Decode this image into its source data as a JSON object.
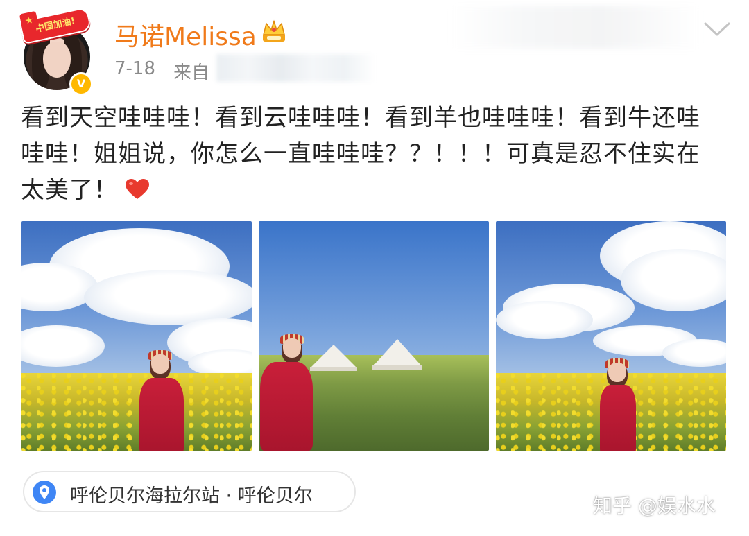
{
  "header": {
    "badge_text": "中国加油!",
    "username": "马诺Melissa",
    "date": "7-18",
    "source_label": "来自",
    "verified_icon": "verified-v-icon",
    "vip_icon": "crown-icon",
    "menu_icon": "chevron-down-icon",
    "colors": {
      "username": "#f07a1a",
      "meta": "#8a8a8a",
      "verified": "#ffb800",
      "badge": "#e8272c"
    }
  },
  "post": {
    "text": "看到天空哇哇哇！看到云哇哇哇！看到羊也哇哇哇！看到牛还哇哇哇！姐姐说，你怎么一直哇哇哇？？！！！可真是忍不住实在太美了！",
    "emoji": "heart-icon"
  },
  "photos": [
    {
      "name": "photo-rapeseed-field-1"
    },
    {
      "name": "photo-grassland-tents"
    },
    {
      "name": "photo-rapeseed-field-2"
    }
  ],
  "location": {
    "icon": "location-pin-icon",
    "place": "呼伦贝尔海拉尔站",
    "separator": "·",
    "city": "呼伦贝尔",
    "accent": "#3f86f5"
  },
  "watermark": "知乎 @娱水水"
}
